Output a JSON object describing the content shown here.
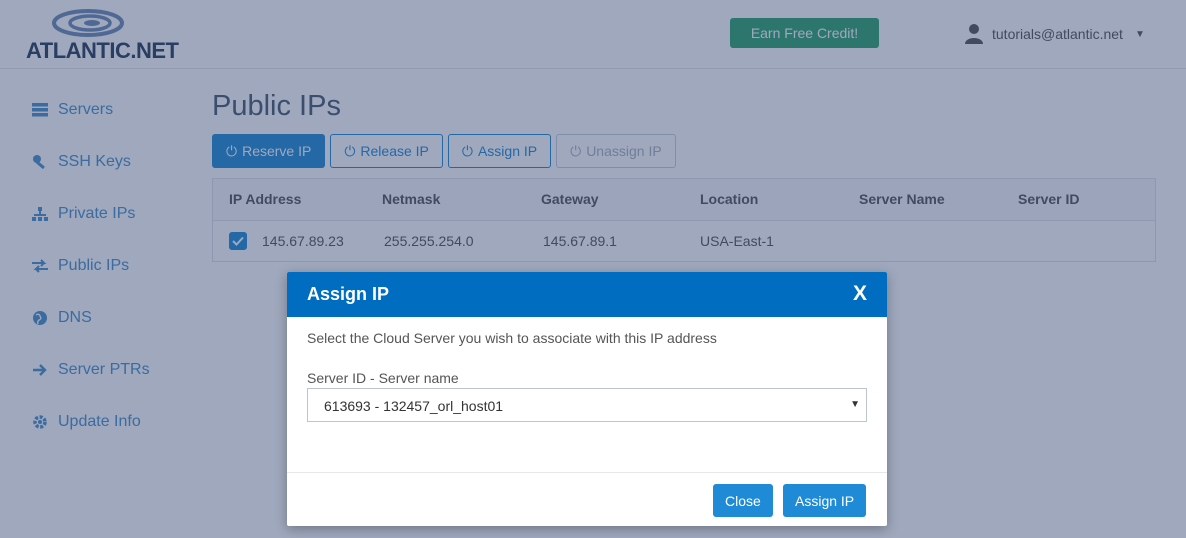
{
  "header": {
    "logo_text": "ATLANTIC.NET",
    "credit_button": "Earn Free Credit!",
    "user_email": "tutorials@atlantic.net"
  },
  "sidebar": {
    "items": [
      {
        "label": "Servers",
        "icon": "server-icon"
      },
      {
        "label": "SSH Keys",
        "icon": "key-icon"
      },
      {
        "label": "Private IPs",
        "icon": "network-icon"
      },
      {
        "label": "Public IPs",
        "icon": "exchange-icon"
      },
      {
        "label": "DNS",
        "icon": "globe-icon"
      },
      {
        "label": "Server PTRs",
        "icon": "arrow-right-icon"
      },
      {
        "label": "Update Info",
        "icon": "gear-icon"
      }
    ]
  },
  "main": {
    "title": "Public IPs",
    "toolbar": {
      "reserve": "Reserve IP",
      "release": "Release IP",
      "assign": "Assign IP",
      "unassign": "Unassign IP"
    },
    "table": {
      "columns": [
        "IP Address",
        "Netmask",
        "Gateway",
        "Location",
        "Server Name",
        "Server ID"
      ],
      "rows": [
        {
          "checked": true,
          "ip": "145.67.89.23",
          "netmask": "255.255.254.0",
          "gateway": "145.67.89.1",
          "location": "USA-East-1",
          "server_name": "",
          "server_id": ""
        }
      ]
    }
  },
  "modal": {
    "title": "Assign IP",
    "close": "X",
    "description": "Select the Cloud Server you wish to associate with this IP address",
    "field_label": "Server ID - Server name",
    "selected_server": "613693 - 132457_orl_host01",
    "close_button": "Close",
    "assign_button": "Assign IP"
  },
  "colors": {
    "primary": "#1f8bd6",
    "modal_header": "#006dc1",
    "credit_button": "#2fa56d",
    "overlay": "#2a3e6c"
  }
}
